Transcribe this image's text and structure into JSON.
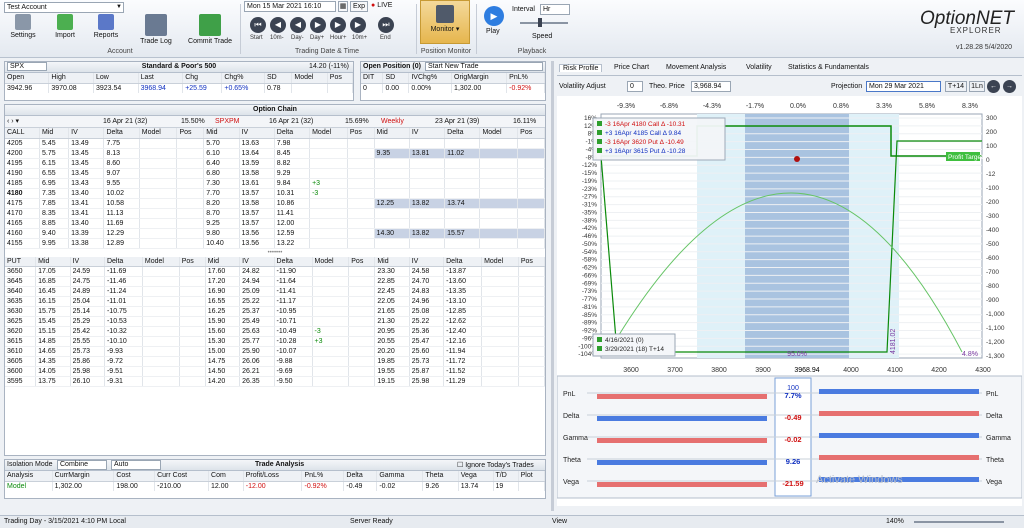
{
  "account": {
    "value": "Test Account"
  },
  "ribbon": {
    "buttons": [
      {
        "label": "Settings"
      },
      {
        "label": "Import"
      },
      {
        "label": "Reports"
      },
      {
        "label": "Trade Log"
      },
      {
        "label": "Commit Trade"
      }
    ],
    "account_group": "Account",
    "date_value": "Mon 15 Mar 2021 16:10",
    "exp_label": "Exp",
    "live_label": "LIVE",
    "nav": [
      "Start",
      "10m-",
      "Day-",
      "Day+",
      "Hour+",
      "10m+",
      "End"
    ],
    "trading_group": "Trading Date & Time",
    "monitor_label": "Monitor",
    "monitor_group": "Position Monitor",
    "play_label": "Play",
    "interval_label": "Interval",
    "interval_value": "Hr",
    "speed_label": "Speed",
    "playback_group": "Playback",
    "brand_top": "OptionNET",
    "brand_bottom": "EXPLORER",
    "version": "v1.28.28  5/4/2020"
  },
  "underlying": {
    "symbol": "SPX",
    "name": "Standard & Poor's 500",
    "change_hdr": "14.20 (-11%)",
    "cols": [
      "Open",
      "High",
      "Low",
      "Last",
      "Chg",
      "Chg%",
      "SD",
      "Model",
      "Pos"
    ],
    "values": [
      "3942.96",
      "3970.08",
      "3923.54",
      "3968.94",
      "+25.59",
      "+0.65%",
      "0.78",
      "",
      ""
    ]
  },
  "open_position": {
    "title": "Open Position (0)",
    "new_trade": "Start New Trade",
    "cols": [
      "DIT",
      "SD",
      "IVChg%",
      "OrigMargin",
      "PnL%"
    ],
    "values": [
      "0",
      "0.00",
      "0.00%",
      "1,302.00",
      "-0.92%"
    ]
  },
  "chain": {
    "title": "Option Chain",
    "exp1": {
      "label": "16 Apr 21 (32)",
      "iv": "15.50%"
    },
    "exp2": {
      "name": "SPXPM",
      "label": "16 Apr 21 (32)",
      "iv": "15.69%"
    },
    "exp3": {
      "name": "Weekly",
      "label": "23 Apr 21 (39)",
      "iv": "16.11%"
    },
    "call_cols": [
      "CALL",
      "Mid",
      "IV",
      "Delta",
      "Model",
      "Pos",
      "Mid",
      "IV",
      "Delta",
      "Model",
      "Pos",
      "Mid",
      "IV",
      "Delta",
      "Model",
      "Pos"
    ],
    "put_cols": [
      "PUT",
      "Mid",
      "IV",
      "Delta",
      "Model",
      "Pos",
      "Mid",
      "IV",
      "Delta",
      "Model",
      "Pos",
      "Mid",
      "IV",
      "Delta",
      "Model",
      "Pos"
    ],
    "calls": [
      [
        "4205",
        "5.45",
        "13.49",
        "7.75",
        "",
        "",
        "5.70",
        "13.63",
        "7.98",
        "",
        "",
        "",
        "",
        "",
        "",
        ""
      ],
      [
        "4200",
        "5.75",
        "13.45",
        "8.13",
        "",
        "",
        "6.10",
        "13.64",
        "8.45",
        "",
        "",
        "9.35",
        "13.81",
        "11.02",
        "",
        ""
      ],
      [
        "4195",
        "6.15",
        "13.45",
        "8.60",
        "",
        "",
        "6.40",
        "13.59",
        "8.82",
        "",
        "",
        "",
        "",
        "",
        "",
        ""
      ],
      [
        "4190",
        "6.55",
        "13.45",
        "9.07",
        "",
        "",
        "6.80",
        "13.58",
        "9.29",
        "",
        "",
        "",
        "",
        "",
        "",
        ""
      ],
      [
        "4185",
        "6.95",
        "13.43",
        "9.55",
        "",
        "",
        "7.30",
        "13.61",
        "9.84",
        "+3",
        "",
        "",
        "",
        "",
        "",
        ""
      ],
      [
        "4180",
        "7.35",
        "13.40",
        "10.02",
        "",
        "",
        "7.70",
        "13.57",
        "10.31",
        "-3",
        "",
        "",
        "",
        "",
        "",
        ""
      ],
      [
        "4175",
        "7.85",
        "13.41",
        "10.58",
        "",
        "",
        "8.20",
        "13.58",
        "10.86",
        "",
        "",
        "12.25",
        "13.82",
        "13.74",
        "",
        ""
      ],
      [
        "4170",
        "8.35",
        "13.41",
        "11.13",
        "",
        "",
        "8.70",
        "13.57",
        "11.41",
        "",
        "",
        "",
        "",
        "",
        "",
        ""
      ],
      [
        "4165",
        "8.85",
        "13.40",
        "11.69",
        "",
        "",
        "9.25",
        "13.57",
        "12.00",
        "",
        "",
        "",
        "",
        "",
        "",
        ""
      ],
      [
        "4160",
        "9.40",
        "13.39",
        "12.29",
        "",
        "",
        "9.80",
        "13.56",
        "12.59",
        "",
        "",
        "14.30",
        "13.82",
        "15.57",
        "",
        ""
      ],
      [
        "4155",
        "9.95",
        "13.38",
        "12.89",
        "",
        "",
        "10.40",
        "13.56",
        "13.22",
        "",
        "",
        "",
        "",
        "",
        "",
        ""
      ]
    ],
    "puts": [
      [
        "3650",
        "17.05",
        "24.59",
        "-11.69",
        "",
        "",
        "17.60",
        "24.82",
        "-11.90",
        "",
        "",
        "23.30",
        "24.58",
        "-13.87",
        "",
        ""
      ],
      [
        "3645",
        "16.85",
        "24.75",
        "-11.46",
        "",
        "",
        "17.20",
        "24.94",
        "-11.64",
        "",
        "",
        "22.85",
        "24.70",
        "-13.60",
        "",
        ""
      ],
      [
        "3640",
        "16.45",
        "24.89",
        "-11.24",
        "",
        "",
        "16.90",
        "25.09",
        "-11.41",
        "",
        "",
        "22.45",
        "24.83",
        "-13.35",
        "",
        ""
      ],
      [
        "3635",
        "16.15",
        "25.04",
        "-11.01",
        "",
        "",
        "16.55",
        "25.22",
        "-11.17",
        "",
        "",
        "22.05",
        "24.96",
        "-13.10",
        "",
        ""
      ],
      [
        "3630",
        "15.75",
        "25.14",
        "-10.75",
        "",
        "",
        "16.25",
        "25.37",
        "-10.95",
        "",
        "",
        "21.65",
        "25.08",
        "-12.85",
        "",
        ""
      ],
      [
        "3625",
        "15.45",
        "25.29",
        "-10.53",
        "",
        "",
        "15.90",
        "25.49",
        "-10.71",
        "",
        "",
        "21.30",
        "25.22",
        "-12.62",
        "",
        ""
      ],
      [
        "3620",
        "15.15",
        "25.42",
        "-10.32",
        "",
        "",
        "15.60",
        "25.63",
        "-10.49",
        "-3",
        "",
        "20.95",
        "25.36",
        "-12.40",
        "",
        ""
      ],
      [
        "3615",
        "14.85",
        "25.55",
        "-10.10",
        "",
        "",
        "15.30",
        "25.77",
        "-10.28",
        "+3",
        "",
        "20.55",
        "25.47",
        "-12.16",
        "",
        ""
      ],
      [
        "3610",
        "14.65",
        "25.73",
        "-9.93",
        "",
        "",
        "15.00",
        "25.90",
        "-10.07",
        "",
        "",
        "20.20",
        "25.60",
        "-11.94",
        "",
        ""
      ],
      [
        "3605",
        "14.35",
        "25.86",
        "-9.72",
        "",
        "",
        "14.75",
        "26.06",
        "-9.88",
        "",
        "",
        "19.85",
        "25.73",
        "-11.72",
        "",
        ""
      ],
      [
        "3600",
        "14.05",
        "25.98",
        "-9.51",
        "",
        "",
        "14.50",
        "26.21",
        "-9.69",
        "",
        "",
        "19.55",
        "25.87",
        "-11.52",
        "",
        ""
      ],
      [
        "3595",
        "13.75",
        "26.10",
        "-9.31",
        "",
        "",
        "14.20",
        "26.35",
        "-9.50",
        "",
        "",
        "19.15",
        "25.98",
        "-11.29",
        "",
        ""
      ]
    ]
  },
  "trade_analysis": {
    "isolation_label": "Isolation Mode",
    "iso_value": "Combine",
    "iso_value2": "Auto",
    "title": "Trade Analysis",
    "ignore_label": "Ignore Today's Trades",
    "cols": [
      "Analysis",
      "CurrMargin",
      "Cost",
      "Curr Cost",
      "Com",
      "Profit/Loss",
      "PnL%",
      "Delta",
      "Gamma",
      "Theta",
      "Vega",
      "T/D",
      "Plot"
    ],
    "row": [
      "Model",
      "1,302.00",
      "198.00",
      "-210.00",
      "12.00",
      "-12.00",
      "-0.92%",
      "-0.49",
      "-0.02",
      "9.26",
      "13.74",
      "19",
      ""
    ]
  },
  "tabs": [
    "Risk Profile",
    "Price Chart",
    "Movement Analysis",
    "Volatility",
    "Statistics & Fundamentals"
  ],
  "risk": {
    "vol_adjust_label": "Volatility Adjust",
    "vol_adjust": "0",
    "theo_label": "Theo. Price",
    "theo_price": "3,968.94",
    "projection_label": "Projection",
    "projection_date": "Mon 29 Mar 2021",
    "t14": "T+14",
    "oneln": "1Ln",
    "pct_top": [
      "-9.3%",
      "-6.8%",
      "-4.3%",
      "-1.7%",
      "0.0%",
      "0.8%",
      "3.3%",
      "5.8%",
      "8.3%"
    ],
    "left_axis": [
      "16%",
      "12%",
      "8%",
      "-1%",
      "-4%",
      "-8%",
      "-12%",
      "-15%",
      "-19%",
      "-23%",
      "-27%",
      "-31%",
      "-35%",
      "-38%",
      "-42%",
      "-46%",
      "-50%",
      "-54%",
      "-58%",
      "-62%",
      "-66%",
      "-69%",
      "-73%",
      "-77%",
      "-81%",
      "-85%",
      "-89%",
      "-92%",
      "-96%",
      "-100%",
      "-104%"
    ],
    "right_axis": [
      "300",
      "200",
      "100",
      "0",
      "-12",
      "-100",
      "-200",
      "-300",
      "-400",
      "-500",
      "-600",
      "-700",
      "-800",
      "-900",
      "-1,000",
      "-1,100",
      "-1,200",
      "-1,300"
    ],
    "x_axis": [
      "3600",
      "3700",
      "3800",
      "3900",
      "3968.94",
      "4000",
      "4100",
      "4200",
      "4300"
    ],
    "legend": [
      {
        "text": "-3 16Apr 4180 Call Δ -10.31",
        "color": "#d01010"
      },
      {
        "text": "+3 16Apr 4185 Call Δ 9.84",
        "color": "#1030c0"
      },
      {
        "text": "-3 16Apr 3620 Put Δ -10.49",
        "color": "#d01010"
      },
      {
        "text": "+3 16Apr 3615 Put Δ -10.28",
        "color": "#1030c0"
      }
    ],
    "date_legend": [
      {
        "text": "4/16/2021 (0)"
      },
      {
        "text": "3/29/2021 (18) T+14"
      }
    ],
    "profit_target": "Profit Target",
    "prob_center": "95.0%",
    "prob_right": "4.8%",
    "marker_label": "4181.02"
  },
  "greeks": {
    "labels": [
      "PnL",
      "Delta",
      "Gamma",
      "Theta",
      "Vega"
    ],
    "center": [
      "7.7%",
      "-0.49",
      "-0.02",
      "9.26",
      "-21.59"
    ],
    "center_top": "100"
  },
  "status": {
    "left": "Trading Day - 3/15/2021 4:10 PM Local",
    "mid": "Server Ready",
    "view": "View",
    "zoom": "140%"
  },
  "watermark": "Activate Windows"
}
